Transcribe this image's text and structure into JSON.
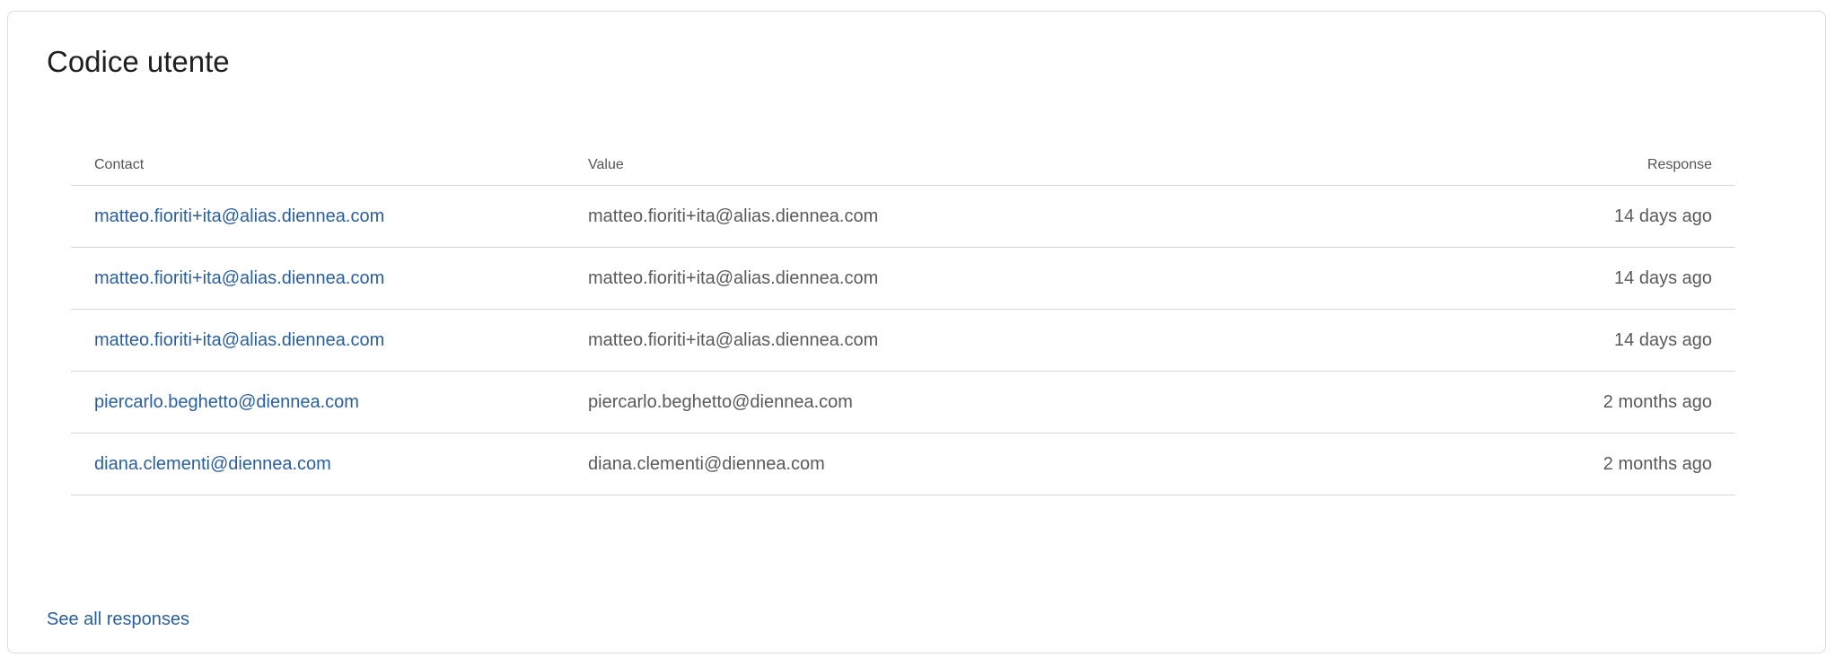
{
  "card": {
    "title": "Codice utente"
  },
  "table": {
    "headers": {
      "contact": "Contact",
      "value": "Value",
      "response": "Response"
    },
    "rows": [
      {
        "contact": "matteo.fioriti+ita@alias.diennea.com",
        "value": "matteo.fioriti+ita@alias.diennea.com",
        "response": "14 days ago"
      },
      {
        "contact": "matteo.fioriti+ita@alias.diennea.com",
        "value": "matteo.fioriti+ita@alias.diennea.com",
        "response": "14 days ago"
      },
      {
        "contact": "matteo.fioriti+ita@alias.diennea.com",
        "value": "matteo.fioriti+ita@alias.diennea.com",
        "response": "14 days ago"
      },
      {
        "contact": "piercarlo.beghetto@diennea.com",
        "value": "piercarlo.beghetto@diennea.com",
        "response": "2 months ago"
      },
      {
        "contact": "diana.clementi@diennea.com",
        "value": "diana.clementi@diennea.com",
        "response": "2 months ago"
      }
    ]
  },
  "footer": {
    "see_all_label": "See all responses"
  },
  "colors": {
    "link": "#2a5f9e",
    "text_muted": "#5a5a5a",
    "border": "#d6d6d6"
  }
}
